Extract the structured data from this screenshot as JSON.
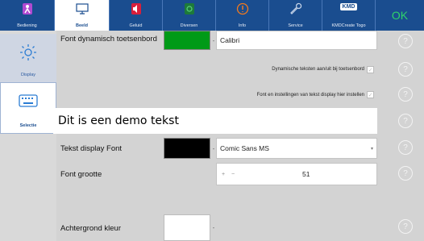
{
  "tabs": [
    {
      "label": "Bediening",
      "icon": "accessibility-icon",
      "active": false
    },
    {
      "label": "Beeld",
      "icon": "monitor-icon",
      "active": true
    },
    {
      "label": "Geluid",
      "icon": "speaker-icon",
      "active": false
    },
    {
      "label": "Diversen",
      "icon": "misc-icon",
      "active": false
    },
    {
      "label": "Info",
      "icon": "info-icon",
      "active": false
    },
    {
      "label": "Service",
      "icon": "wrench-icon",
      "active": false
    },
    {
      "label": "KMDCreate Togo",
      "icon": "kmd-logo-icon",
      "active": false
    }
  ],
  "kmd_logo_text": "KMD",
  "ok_label": "OK",
  "sidebar": [
    {
      "label": "Display",
      "icon": "brightness-icon",
      "selected": false
    },
    {
      "label": "Selectie",
      "icon": "keyboard-icon",
      "selected": true
    }
  ],
  "settings": {
    "dynamic_font_label": "Font dynamisch toetsenbord",
    "dynamic_font_color": "#009a17",
    "dynamic_font_value": "Calibri",
    "dynamic_text_toggle_label": "Dynamische teksten aan/uit bij toetsenbord",
    "font_settings_toggle_label": "Font en instellingen van tekst display hier instellen",
    "demo_text": "Dit is een demo tekst",
    "text_display_font_label": "Tekst display Font",
    "text_display_font_color": "#000000",
    "text_display_font_value": "Comic Sans MS",
    "font_size_label": "Font grootte",
    "font_size_value": "51",
    "stepper_plus": "+",
    "stepper_minus": "−",
    "background_color_label": "Achtergrond kleur",
    "background_color_value": "#ffffff"
  },
  "help_symbol": "?",
  "colors": {
    "topbar": "#1a4d8f",
    "ok_text": "#2fd36b",
    "panel": "#d3d3d3"
  }
}
